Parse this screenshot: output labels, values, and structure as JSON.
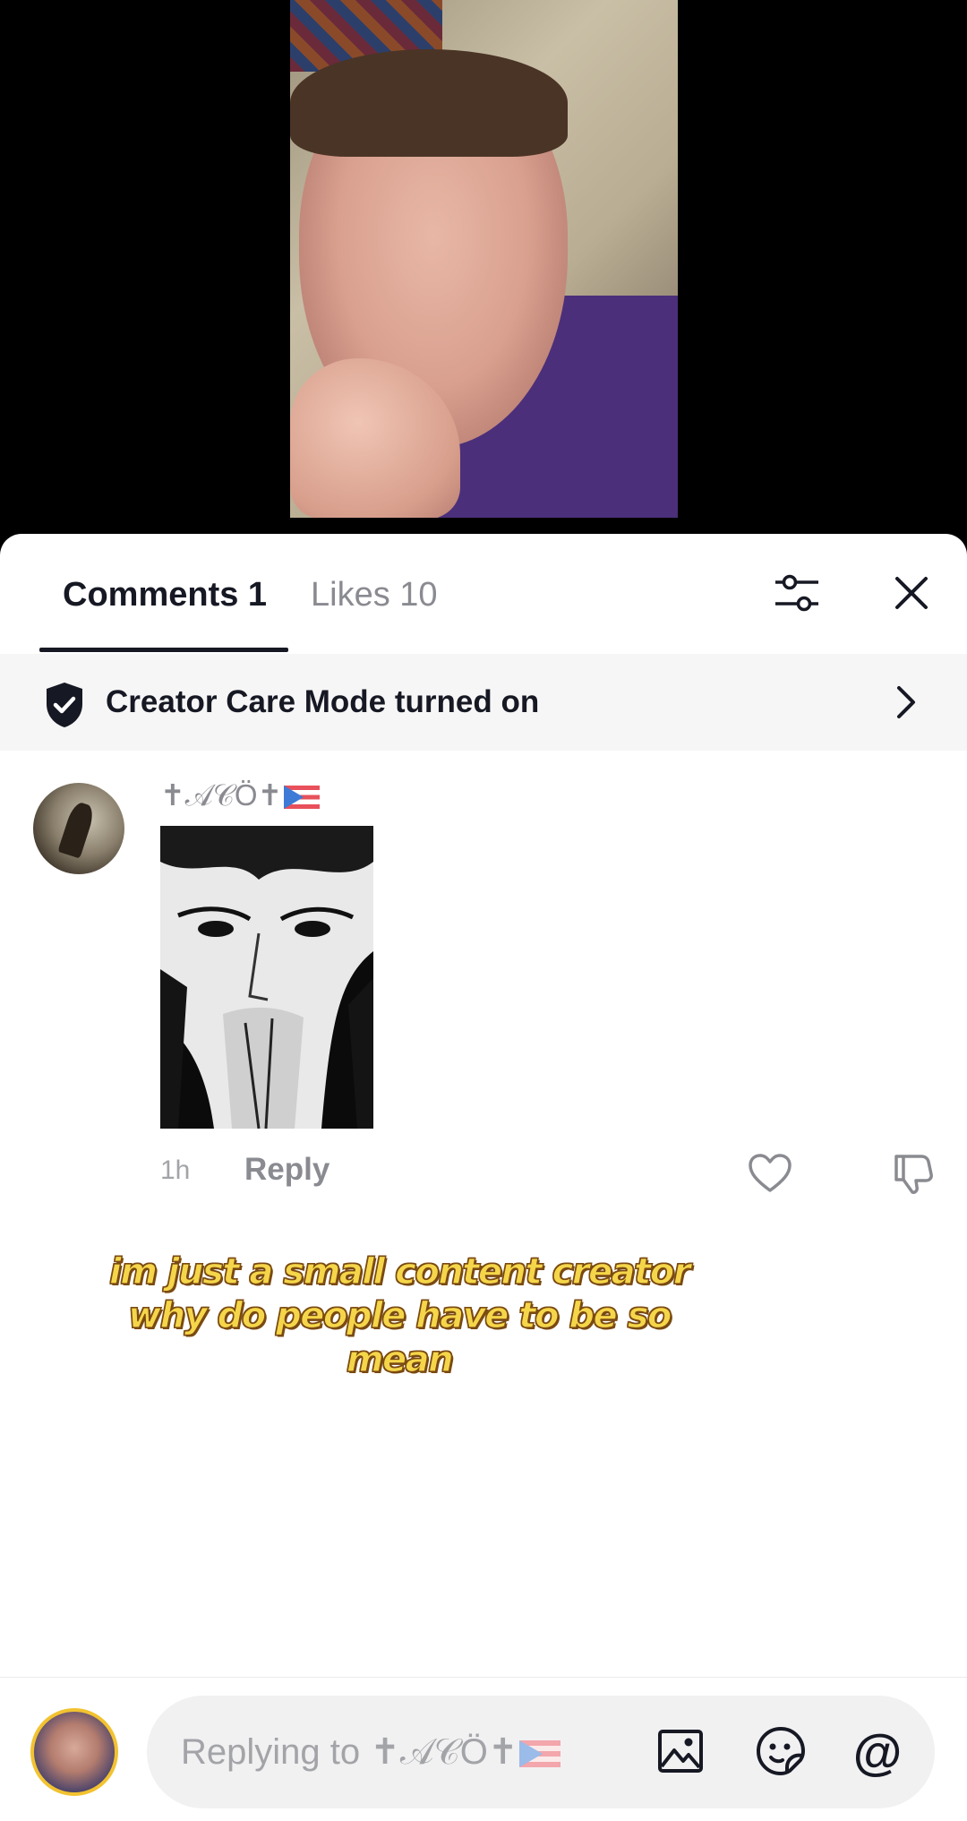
{
  "tabs": {
    "comments_label": "Comments 1",
    "likes_label": "Likes 10"
  },
  "banner": {
    "text": "Creator Care Mode turned on"
  },
  "comment": {
    "username": "✝𝒜𝒞Ö✝",
    "time": "1h",
    "reply_label": "Reply"
  },
  "caption": {
    "line1": "im just a small content creator",
    "line2": "why do people have to be so",
    "line3": "mean"
  },
  "composer": {
    "placeholder": "Replying to ✝𝒜𝒞Ö✝",
    "mention_symbol": "@"
  },
  "icons": {
    "filter": "sliders-icon",
    "close": "close-icon",
    "shield": "shield-check-icon",
    "chevron": "chevron-right-icon",
    "like": "heart-icon",
    "dislike": "thumbs-down-icon",
    "image": "image-icon",
    "sticker": "sticker-icon",
    "mention": "at-icon"
  },
  "colors": {
    "text_primary": "#161823",
    "text_secondary": "#8a8b91",
    "caption_fill": "#f5d64a",
    "banner_bg": "#f6f6f6"
  }
}
